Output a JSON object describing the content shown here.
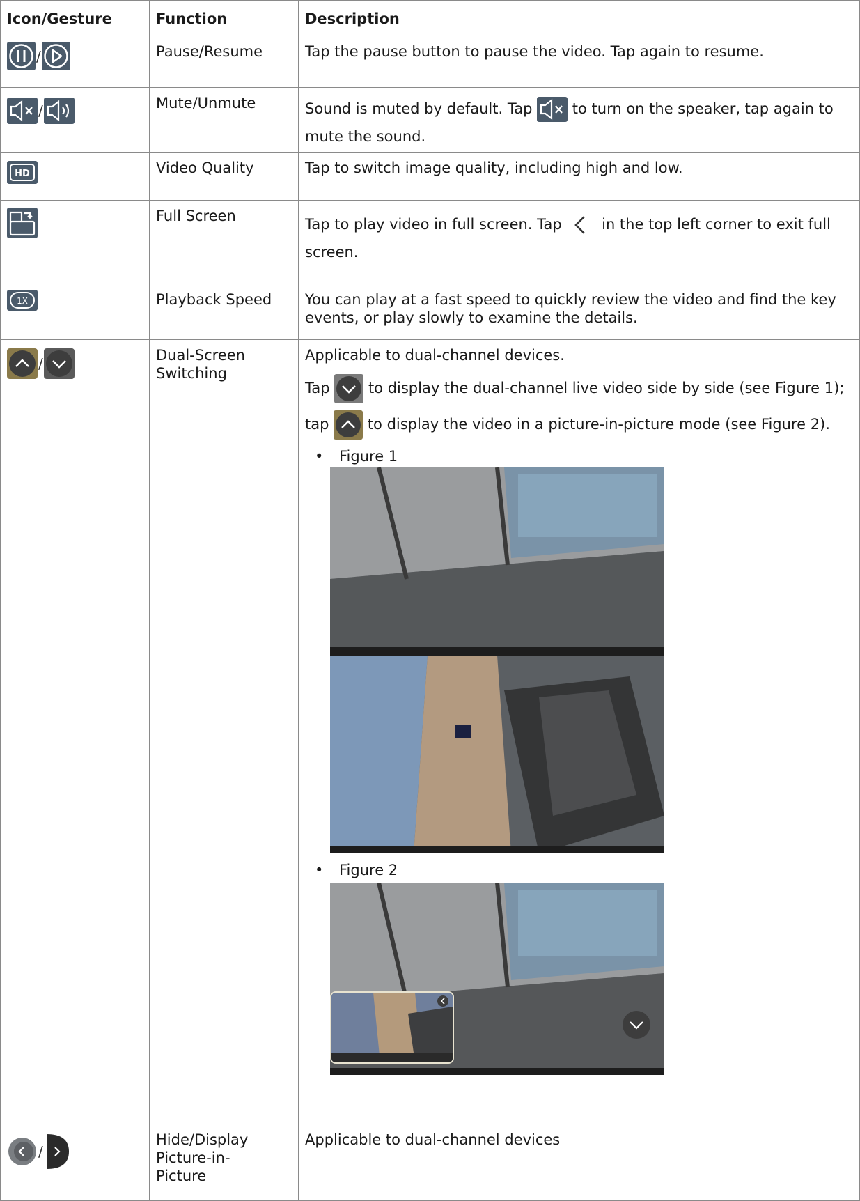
{
  "header": {
    "col1": "Icon/Gesture",
    "col2": "Function",
    "col3": "Description"
  },
  "rows": {
    "pause": {
      "function": "Pause/Resume",
      "description": "Tap the pause button to pause the video. Tap again to resume.",
      "icons": [
        "pause-icon",
        "play-icon"
      ]
    },
    "mute": {
      "function": "Mute/Unmute",
      "desc_a": "Sound is muted by default. Tap",
      "desc_b": "to turn on the speaker, tap again to",
      "desc_c": "mute the sound.",
      "icons": [
        "speaker-muted-icon",
        "speaker-on-icon"
      ]
    },
    "hd": {
      "function": "Video Quality",
      "description": "Tap to switch image quality, including high and low.",
      "icon_text": "HD"
    },
    "full": {
      "function": "Full Screen",
      "desc_a": "Tap to play video in full screen. Tap",
      "desc_b": "in the top left corner to exit full",
      "desc_c": "screen.",
      "icons": [
        "fullscreen-icon",
        "back-chevron-icon"
      ]
    },
    "speed": {
      "function": "Playback Speed",
      "description": "You can play at a fast speed to quickly review the video and find the key events, or play slowly to examine the details.",
      "icon_text": "1X"
    },
    "dual": {
      "function_a": "Dual-Screen",
      "function_b": "Switching",
      "line1": "Applicable to dual-channel devices.",
      "line2_a": "Tap",
      "line2_b": "to display the dual-channel live video side by side (see Figure 1);",
      "line3_a": "tap",
      "line3_b": "to display the video in a picture-in-picture mode (see Figure 2).",
      "bullet": "•",
      "figure1": "Figure 1",
      "figure2": "Figure 2"
    },
    "hide": {
      "function_a": "Hide/Display",
      "function_b": "Picture-in-",
      "function_c": "Picture",
      "description": "Applicable to dual-channel devices"
    }
  },
  "slash": "/",
  "colors": {
    "icon_bg": "#4a5a6a",
    "border": "#8a8a8a"
  }
}
